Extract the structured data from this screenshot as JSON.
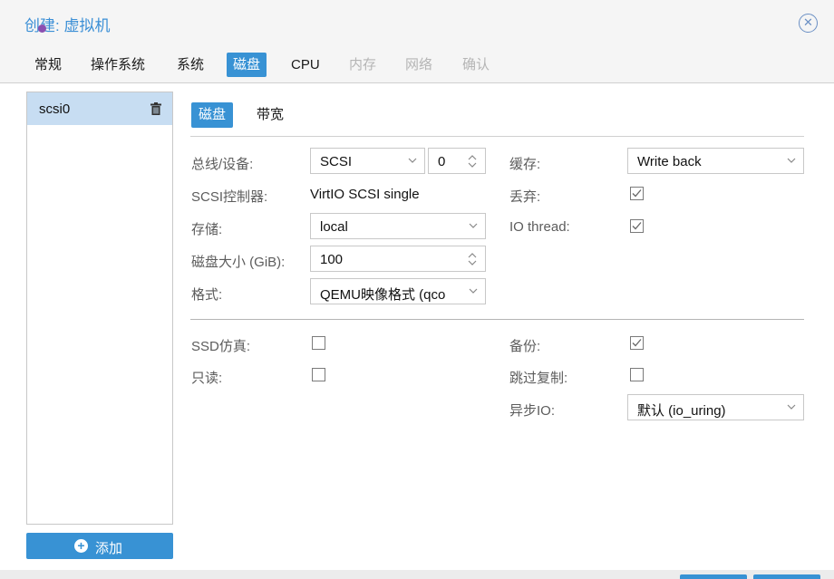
{
  "window": {
    "title": "创建: 虚拟机"
  },
  "tabs": [
    {
      "label": "常规",
      "state": "normal"
    },
    {
      "label": "操作系统",
      "state": "normal"
    },
    {
      "label": "系统",
      "state": "normal"
    },
    {
      "label": "磁盘",
      "state": "active"
    },
    {
      "label": "CPU",
      "state": "normal"
    },
    {
      "label": "内存",
      "state": "disabled"
    },
    {
      "label": "网络",
      "state": "disabled"
    },
    {
      "label": "确认",
      "state": "disabled"
    }
  ],
  "disk_list": {
    "items": [
      {
        "label": "scsi0",
        "selected": true
      }
    ],
    "add_label": "添加"
  },
  "subtabs": [
    {
      "label": "磁盘",
      "active": true
    },
    {
      "label": "带宽",
      "active": false
    }
  ],
  "form": {
    "bus_device": {
      "label": "总线/设备:",
      "bus": "SCSI",
      "device": "0"
    },
    "scsi_controller": {
      "label": "SCSI控制器:",
      "value": "VirtIO SCSI single"
    },
    "storage": {
      "label": "存储:",
      "value": "local"
    },
    "disk_size": {
      "label": "磁盘大小 (GiB):",
      "value": "100"
    },
    "format": {
      "label": "格式:",
      "value": "QEMU映像格式 (qco"
    },
    "cache": {
      "label": "缓存:",
      "value": "Write back"
    },
    "discard": {
      "label": "丢弃:",
      "checked": true
    },
    "io_thread": {
      "label": "IO thread:",
      "checked": true
    },
    "ssd_emulation": {
      "label": "SSD仿真:",
      "checked": false
    },
    "readonly": {
      "label": "只读:",
      "checked": false
    },
    "backup": {
      "label": "备份:",
      "checked": true
    },
    "skip_replication": {
      "label": "跳过复制:",
      "checked": false
    },
    "async_io": {
      "label": "异步IO:",
      "value": "默认 (io_uring)"
    }
  },
  "colors": {
    "accent": "#3892d4",
    "selected_row": "#c7ddf2",
    "title": "#3b8fd6"
  }
}
